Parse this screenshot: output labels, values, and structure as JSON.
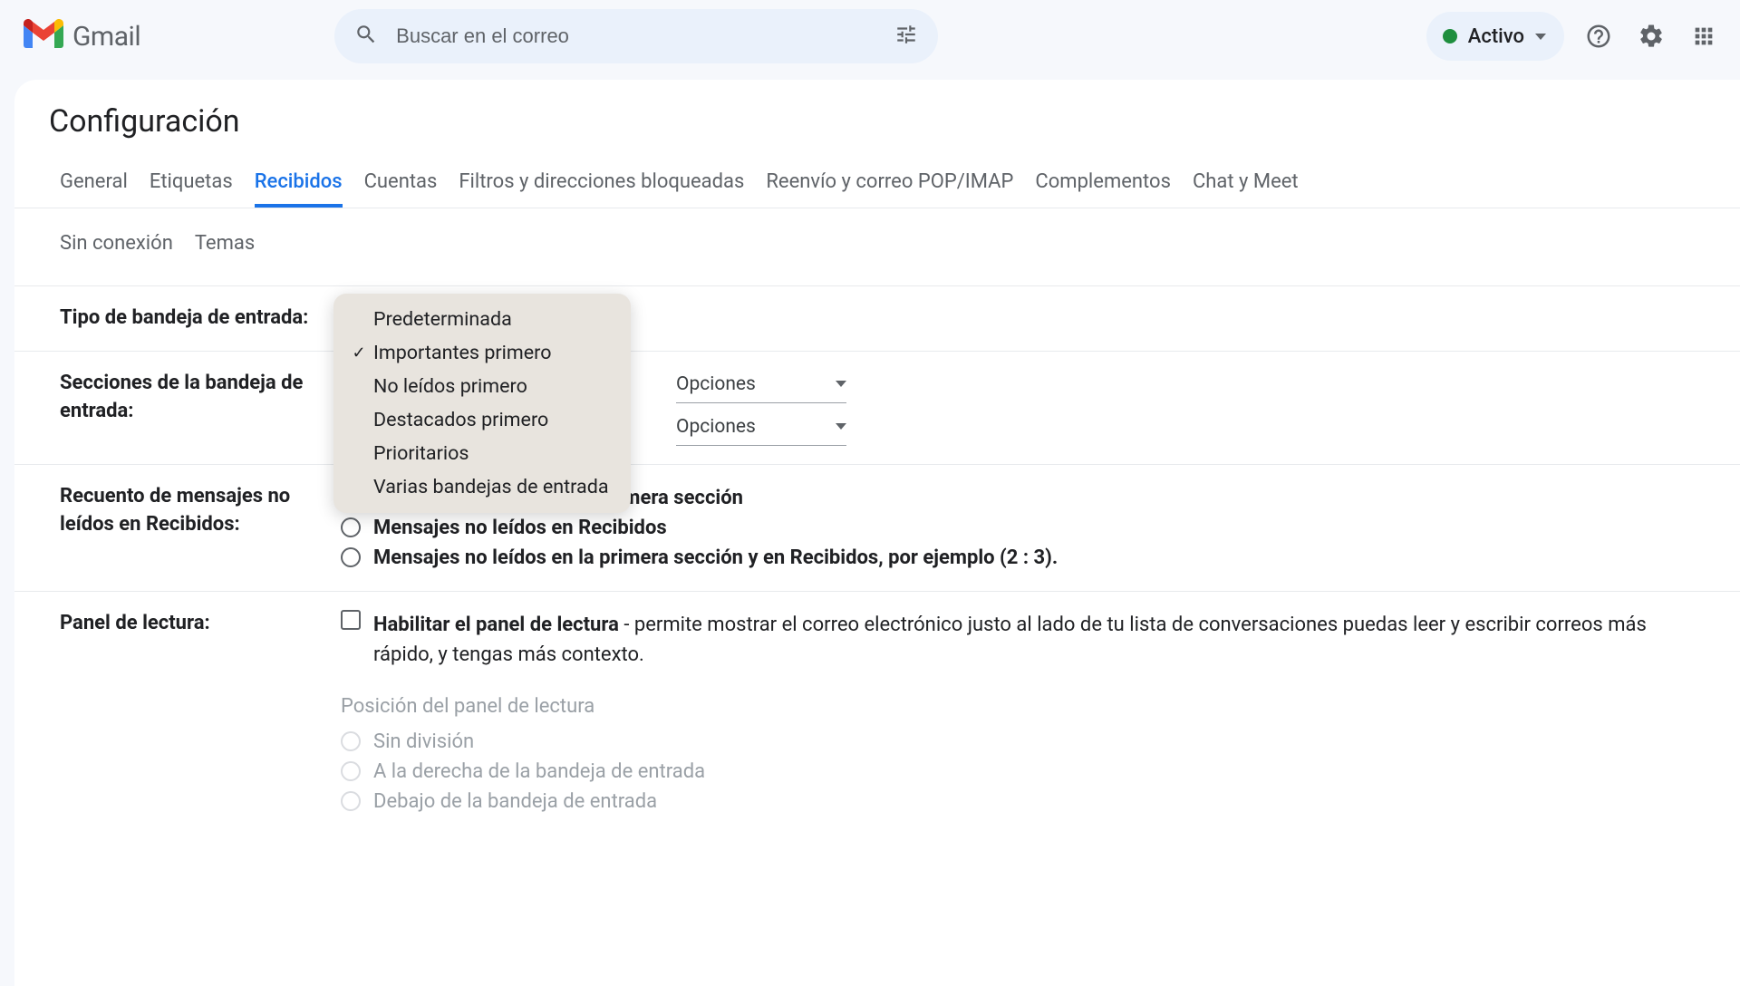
{
  "header": {
    "product": "Gmail",
    "search_placeholder": "Buscar en el correo",
    "status_label": "Activo"
  },
  "page_title": "Configuración",
  "tabs": {
    "row1": [
      "General",
      "Etiquetas",
      "Recibidos",
      "Cuentas",
      "Filtros y direcciones bloqueadas",
      "Reenvío y correo POP/IMAP",
      "Complementos",
      "Chat y Meet"
    ],
    "row2": [
      "Sin conexión",
      "Temas"
    ],
    "active_index": 2
  },
  "inbox_type": {
    "label": "Tipo de bandeja de entrada:",
    "dropdown": {
      "options": [
        "Predeterminada",
        "Importantes primero",
        "No leídos primero",
        "Destacados primero",
        "Prioritarios",
        "Varias bandejas de entrada"
      ],
      "selected_index": 1
    }
  },
  "sections": {
    "label": "Secciones de la bandeja de entrada:",
    "options_label": "Opciones"
  },
  "unread_count": {
    "label": "Recuento de mensajes no leídos en Recibidos:",
    "options": [
      "Mensajes no leídos en la primera sección",
      "Mensajes no leídos en Recibidos",
      "Mensajes no leídos en la primera sección y en Recibidos, por ejemplo (2 : 3)."
    ],
    "selected_index": 0
  },
  "reading_pane": {
    "label": "Panel de lectura:",
    "checkbox_bold": "Habilitar el panel de lectura",
    "checkbox_rest": " - permite mostrar el correo electrónico justo al lado de tu lista de conversaciones puedas leer y escribir correos más rápido, y tengas más contexto.",
    "position_title": "Posición del panel de lectura",
    "position_options": [
      "Sin división",
      "A la derecha de la bandeja de entrada",
      "Debajo de la bandeja de entrada"
    ]
  }
}
